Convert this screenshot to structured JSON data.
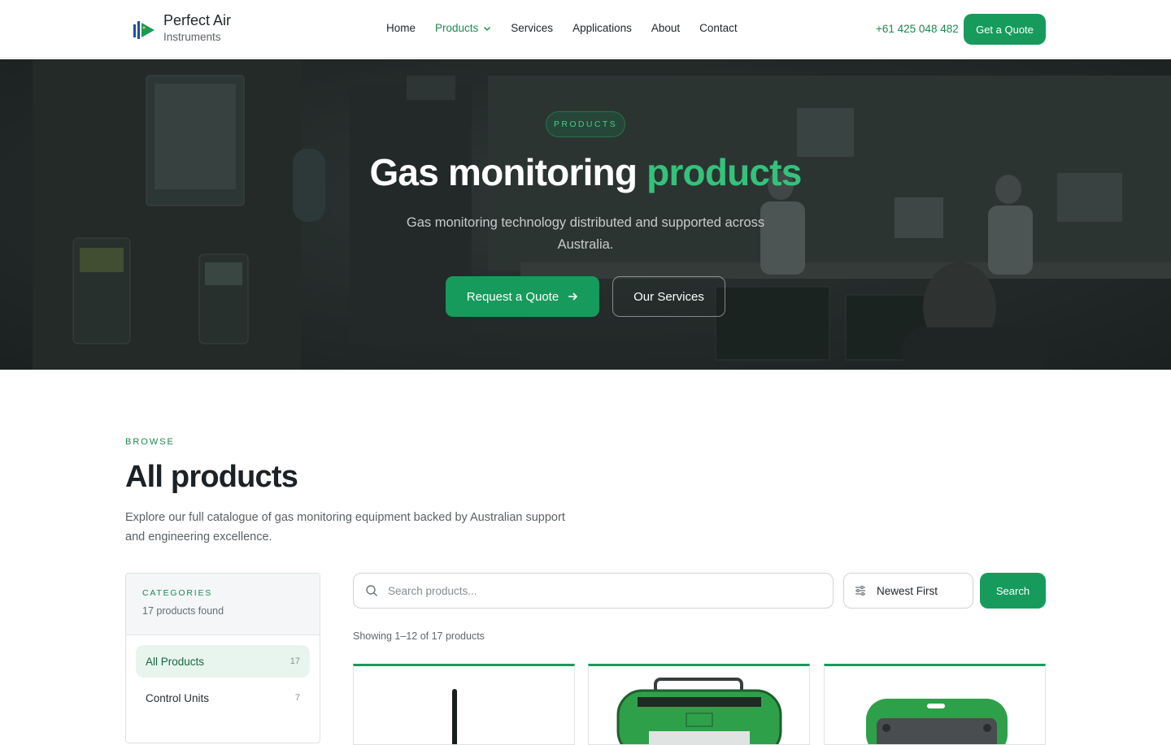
{
  "header": {
    "brand_title": "Perfect Air",
    "brand_subtitle": "Instruments",
    "nav": [
      "Home",
      "Products",
      "Services",
      "Applications",
      "About",
      "Contact"
    ],
    "active_nav": "Products",
    "phone": "+61 425 048 482",
    "cta": "Get a Quote"
  },
  "hero": {
    "pill": "PRODUCTS",
    "title_main": "Gas monitoring ",
    "title_accent": "products",
    "description": "Gas monitoring technology distributed and supported across Australia.",
    "primary_button": "Request a Quote",
    "secondary_button": "Our Services"
  },
  "browse": {
    "eyebrow": "BROWSE",
    "title": "All products",
    "description": "Explore our full catalogue of gas monitoring equipment backed by Australian support and engineering excellence."
  },
  "sidebar": {
    "label": "CATEGORIES",
    "count_text": "17 products found",
    "categories": [
      {
        "label": "All Products",
        "count": "17"
      },
      {
        "label": "Control Units",
        "count": "7"
      }
    ]
  },
  "toolbar": {
    "search_placeholder": "Search products...",
    "sort_value": "Newest First",
    "search_button": "Search",
    "showing": "Showing 1–12 of 17 products"
  },
  "colors": {
    "brand_green": "#169b5c",
    "accent_text": "#1a8a52",
    "hero_accent": "#34c27a"
  },
  "icons": [
    "logo-icon",
    "chevron-down-icon",
    "arrow-right-icon",
    "search-icon",
    "sliders-icon"
  ]
}
